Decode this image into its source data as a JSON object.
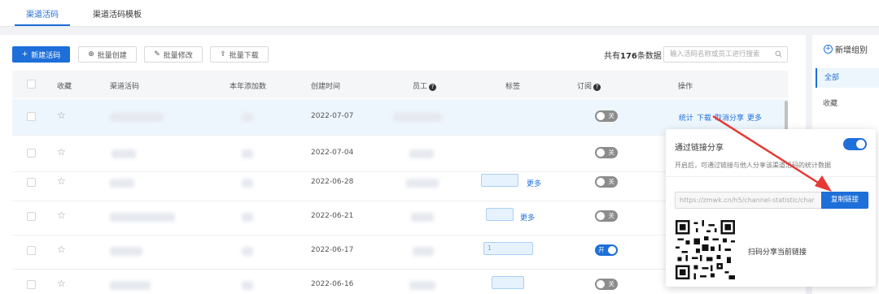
{
  "tabs": [
    {
      "label": "渠道活码",
      "active": true
    },
    {
      "label": "渠道活码模板",
      "active": false
    }
  ],
  "toolbar": {
    "new_label": "新建活码",
    "batch_create_label": "批量创建",
    "batch_edit_label": "批量修改",
    "batch_download_label": "批量下载",
    "total_prefix": "共有",
    "total_count": "176",
    "total_suffix": "条数据",
    "search_placeholder": "输入活码名称或员工进行搜索"
  },
  "table": {
    "headers": [
      "收藏",
      "渠道活码",
      "本年添加数",
      "创建时间",
      "员工",
      "标签",
      "订阅",
      "操作"
    ],
    "rows": [
      {
        "date": "2022-07-07",
        "more": "",
        "tag_text": "",
        "subscription": "关",
        "subscription_on": false
      },
      {
        "date": "2022-07-04",
        "more": "",
        "tag_text": "",
        "subscription": "关",
        "subscription_on": false
      },
      {
        "date": "2022-06-28",
        "more": "更多",
        "tag_text": "",
        "subscription": "关",
        "subscription_on": false
      },
      {
        "date": "2022-06-21",
        "more": "更多",
        "tag_text": "",
        "subscription": "关",
        "subscription_on": false
      },
      {
        "date": "2022-06-17",
        "more": "",
        "tag_text": "1",
        "subscription": "开",
        "subscription_on": true
      },
      {
        "date": "2022-06-16",
        "more": "",
        "tag_text": "",
        "subscription": "关",
        "subscription_on": false
      }
    ],
    "ops": [
      "统计",
      "下载",
      "取消分享",
      "更多"
    ]
  },
  "sidebar": {
    "add_label": "新增组别",
    "items": [
      "全部",
      "收藏"
    ]
  },
  "popover": {
    "title": "通过链接分享",
    "desc": "开启后，可通过链接与他人分享该渠道活码的统计数据",
    "link": "https://zmwk.cn/h5/channel-statistic/char",
    "copy_label": "复制链接",
    "qr_label": "扫码分享当前链接",
    "share_enabled": true
  },
  "colors": {
    "accent": "#1e6fd9",
    "arrow": "#e53935"
  }
}
